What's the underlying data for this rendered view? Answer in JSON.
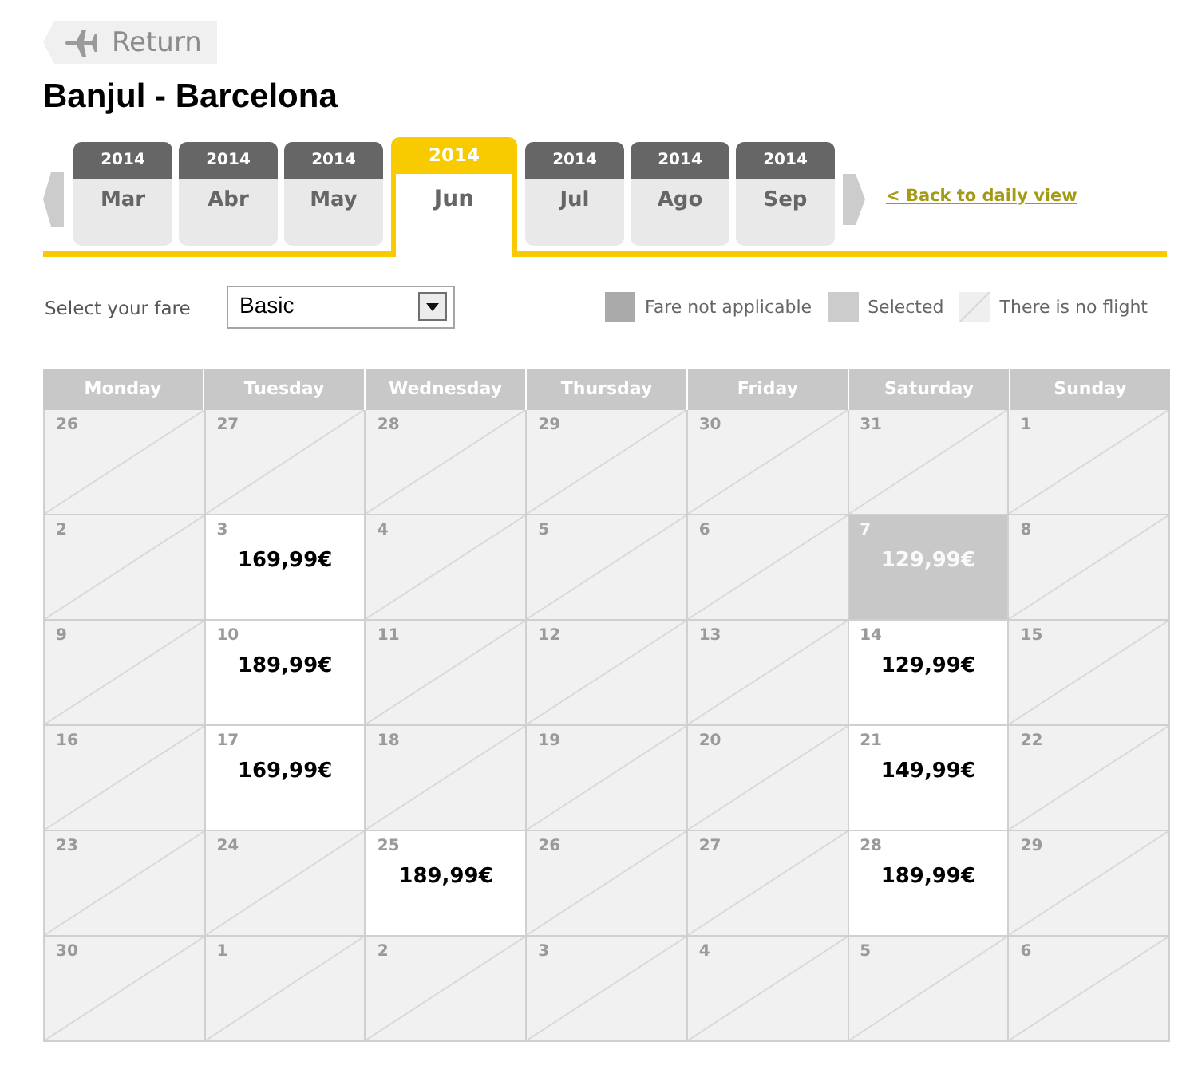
{
  "back_button": {
    "label": "Return"
  },
  "route_title": "Banjul - Barcelona",
  "month_tabs": [
    {
      "year": "2014",
      "month": "Mar",
      "selected": false
    },
    {
      "year": "2014",
      "month": "Abr",
      "selected": false
    },
    {
      "year": "2014",
      "month": "May",
      "selected": false
    },
    {
      "year": "2014",
      "month": "Jun",
      "selected": true
    },
    {
      "year": "2014",
      "month": "Jul",
      "selected": false
    },
    {
      "year": "2014",
      "month": "Ago",
      "selected": false
    },
    {
      "year": "2014",
      "month": "Sep",
      "selected": false
    }
  ],
  "daily_view_link": "< Back to daily view",
  "fare_selector": {
    "label": "Select your fare",
    "value": "Basic"
  },
  "legend": [
    {
      "kind": "not_applicable",
      "label": "Fare not applicable"
    },
    {
      "kind": "selected",
      "label": "Selected"
    },
    {
      "kind": "no_flight",
      "label": "There is no flight"
    }
  ],
  "calendar": {
    "weekdays": [
      "Monday",
      "Tuesday",
      "Wednesday",
      "Thursday",
      "Friday",
      "Saturday",
      "Sunday"
    ],
    "weeks": [
      [
        {
          "day": "26",
          "kind": "no_flight",
          "selected": false
        },
        {
          "day": "27",
          "kind": "no_flight",
          "selected": false
        },
        {
          "day": "28",
          "kind": "no_flight",
          "selected": false
        },
        {
          "day": "29",
          "kind": "no_flight",
          "selected": false
        },
        {
          "day": "30",
          "kind": "no_flight",
          "selected": false
        },
        {
          "day": "31",
          "kind": "no_flight",
          "selected": false
        },
        {
          "day": "1",
          "kind": "no_flight",
          "selected": false
        }
      ],
      [
        {
          "day": "2",
          "kind": "no_flight",
          "selected": false
        },
        {
          "day": "3",
          "kind": "fare",
          "price": "169,99€",
          "selected": false
        },
        {
          "day": "4",
          "kind": "no_flight",
          "selected": false
        },
        {
          "day": "5",
          "kind": "no_flight",
          "selected": false
        },
        {
          "day": "6",
          "kind": "no_flight",
          "selected": false
        },
        {
          "day": "7",
          "kind": "fare",
          "price": "129,99€",
          "selected": true
        },
        {
          "day": "8",
          "kind": "no_flight",
          "selected": false
        }
      ],
      [
        {
          "day": "9",
          "kind": "no_flight",
          "selected": false
        },
        {
          "day": "10",
          "kind": "fare",
          "price": "189,99€",
          "selected": false
        },
        {
          "day": "11",
          "kind": "no_flight",
          "selected": false
        },
        {
          "day": "12",
          "kind": "no_flight",
          "selected": false
        },
        {
          "day": "13",
          "kind": "no_flight",
          "selected": false
        },
        {
          "day": "14",
          "kind": "fare",
          "price": "129,99€",
          "selected": false
        },
        {
          "day": "15",
          "kind": "no_flight",
          "selected": false
        }
      ],
      [
        {
          "day": "16",
          "kind": "no_flight",
          "selected": false
        },
        {
          "day": "17",
          "kind": "fare",
          "price": "169,99€",
          "selected": false
        },
        {
          "day": "18",
          "kind": "no_flight",
          "selected": false
        },
        {
          "day": "19",
          "kind": "no_flight",
          "selected": false
        },
        {
          "day": "20",
          "kind": "no_flight",
          "selected": false
        },
        {
          "day": "21",
          "kind": "fare",
          "price": "149,99€",
          "selected": false
        },
        {
          "day": "22",
          "kind": "no_flight",
          "selected": false
        }
      ],
      [
        {
          "day": "23",
          "kind": "no_flight",
          "selected": false
        },
        {
          "day": "24",
          "kind": "no_flight",
          "selected": false
        },
        {
          "day": "25",
          "kind": "fare",
          "price": "189,99€",
          "selected": false
        },
        {
          "day": "26",
          "kind": "no_flight",
          "selected": false
        },
        {
          "day": "27",
          "kind": "no_flight",
          "selected": false
        },
        {
          "day": "28",
          "kind": "fare",
          "price": "189,99€",
          "selected": false
        },
        {
          "day": "29",
          "kind": "no_flight",
          "selected": false
        }
      ],
      [
        {
          "day": "30",
          "kind": "no_flight",
          "selected": false
        },
        {
          "day": "1",
          "kind": "no_flight",
          "selected": false
        },
        {
          "day": "2",
          "kind": "no_flight",
          "selected": false
        },
        {
          "day": "3",
          "kind": "no_flight",
          "selected": false
        },
        {
          "day": "4",
          "kind": "no_flight",
          "selected": false
        },
        {
          "day": "5",
          "kind": "no_flight",
          "selected": false
        },
        {
          "day": "6",
          "kind": "no_flight",
          "selected": false
        }
      ]
    ]
  }
}
